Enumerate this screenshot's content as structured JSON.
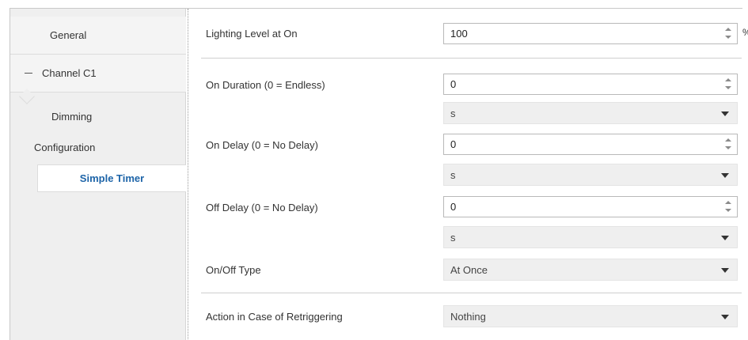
{
  "sidebar": {
    "general": "General",
    "channel": "Channel C1",
    "dimming": "Dimming",
    "configuration": "Configuration",
    "simple_timer": "Simple Timer"
  },
  "fields": {
    "lighting_level": {
      "label": "Lighting Level at On",
      "value": "100",
      "unit": "%"
    },
    "on_duration": {
      "label": "On Duration (0 = Endless)",
      "value": "0",
      "unit": "s"
    },
    "on_delay": {
      "label": "On Delay (0 = No Delay)",
      "value": "0",
      "unit": "s"
    },
    "off_delay": {
      "label": "Off Delay (0 = No Delay)",
      "value": "0",
      "unit": "s"
    },
    "onoff_type": {
      "label": "On/Off Type",
      "value": "At Once"
    },
    "retrigger": {
      "label": "Action in Case of Retriggering",
      "value": "Nothing"
    }
  },
  "colors": {
    "selected_text": "#1d64a8",
    "sidebar_bg": "#efefef",
    "select_bg": "#efefef"
  }
}
